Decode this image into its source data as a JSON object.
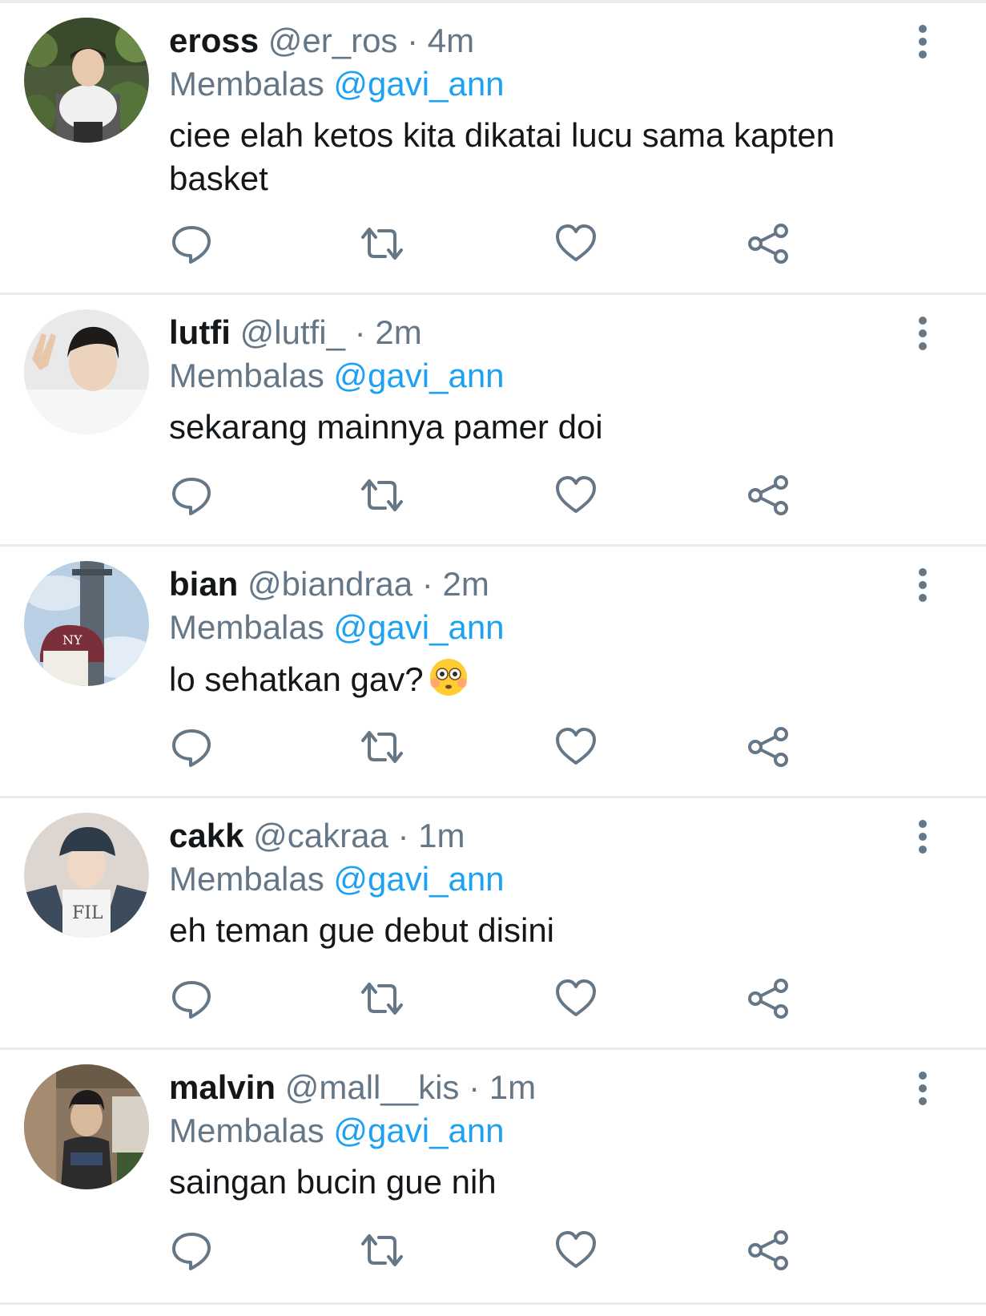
{
  "reply_prefix": "Membalas",
  "tweets": [
    {
      "name": "eross",
      "handle": "@er_ros",
      "sep": "·",
      "time": "4m",
      "reply_to": "@gavi_ann",
      "text": "ciee elah ketos kita dikatai lucu sama kapten basket"
    },
    {
      "name": "lutfi",
      "handle": "@lutfi_",
      "sep": "·",
      "time": "2m",
      "reply_to": "@gavi_ann",
      "text": "sekarang mainnya pamer doi"
    },
    {
      "name": "bian",
      "handle": "@biandraa",
      "sep": "·",
      "time": "2m",
      "reply_to": "@gavi_ann",
      "text": "lo sehatkan gav?"
    },
    {
      "name": "cakk",
      "handle": "@cakraa",
      "sep": "·",
      "time": "1m",
      "reply_to": "@gavi_ann",
      "text": "eh teman gue debut disini"
    },
    {
      "name": "malvin",
      "handle": "@mall__kis",
      "sep": "·",
      "time": "1m",
      "reply_to": "@gavi_ann",
      "text": "saingan bucin gue nih"
    }
  ],
  "avatar_fil_text": "FIL",
  "colors": {
    "text_primary": "#14171a",
    "text_secondary": "#657786",
    "accent": "#1da1f2",
    "divider": "#e6ecf0",
    "icon": "#657786"
  },
  "icons": [
    "reply-icon",
    "retweet-icon",
    "like-icon",
    "share-icon",
    "more-vertical-icon",
    "flushed-face-emoji"
  ]
}
